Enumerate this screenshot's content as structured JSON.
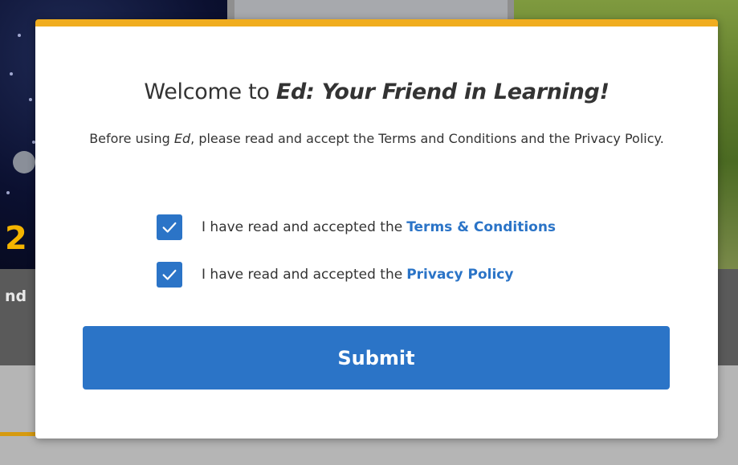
{
  "background": {
    "lower_strip_text": "nd",
    "space_card_number": "2"
  },
  "modal": {
    "title_prefix": "Welcome to ",
    "title_brand": "Ed: Your Friend in Learning!",
    "description_before": "Before using ",
    "description_brand": "Ed",
    "description_after": ", please read and accept the Terms and Conditions and the Privacy Policy.",
    "checkboxes": [
      {
        "checked": true,
        "label": "I have read and accepted the",
        "link": "Terms & Conditions"
      },
      {
        "checked": true,
        "label": "I have read and accepted the",
        "link": "Privacy Policy"
      }
    ],
    "submit_label": "Submit"
  },
  "colors": {
    "accent_top_bar": "#f0ad1f",
    "primary_blue": "#2b74c7",
    "text": "#333333"
  }
}
